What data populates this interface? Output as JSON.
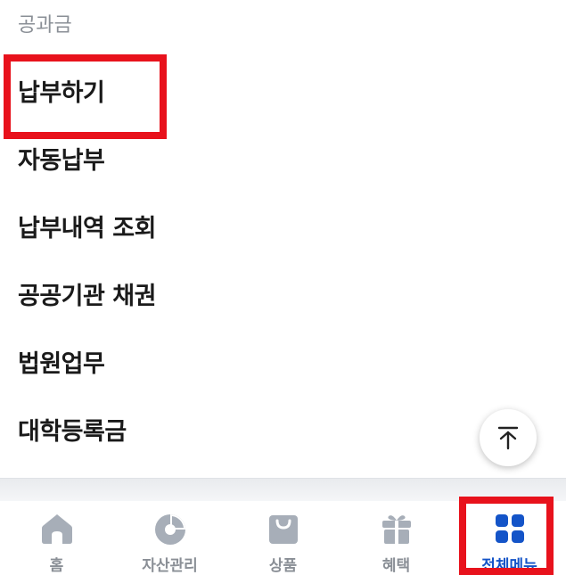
{
  "section": {
    "title": "공과금"
  },
  "menu": {
    "items": [
      {
        "label": "납부하기"
      },
      {
        "label": "자동납부"
      },
      {
        "label": "납부내역 조회"
      },
      {
        "label": "공공기관 채권"
      },
      {
        "label": "법원업무"
      },
      {
        "label": "대학등록금"
      }
    ]
  },
  "scroll_top": {
    "icon": "arrow-up-to-top-icon"
  },
  "tabbar": {
    "tabs": [
      {
        "label": "홈",
        "icon": "home-icon"
      },
      {
        "label": "자산관리",
        "icon": "pie-chart-icon"
      },
      {
        "label": "상품",
        "icon": "shopping-bag-icon"
      },
      {
        "label": "혜택",
        "icon": "gift-icon"
      },
      {
        "label": "전체메뉴",
        "icon": "grid-menu-icon",
        "active": true
      }
    ]
  },
  "colors": {
    "highlight": "#e8121c",
    "active_tab": "#1454c8",
    "inactive_icon": "#a7aeb8"
  }
}
